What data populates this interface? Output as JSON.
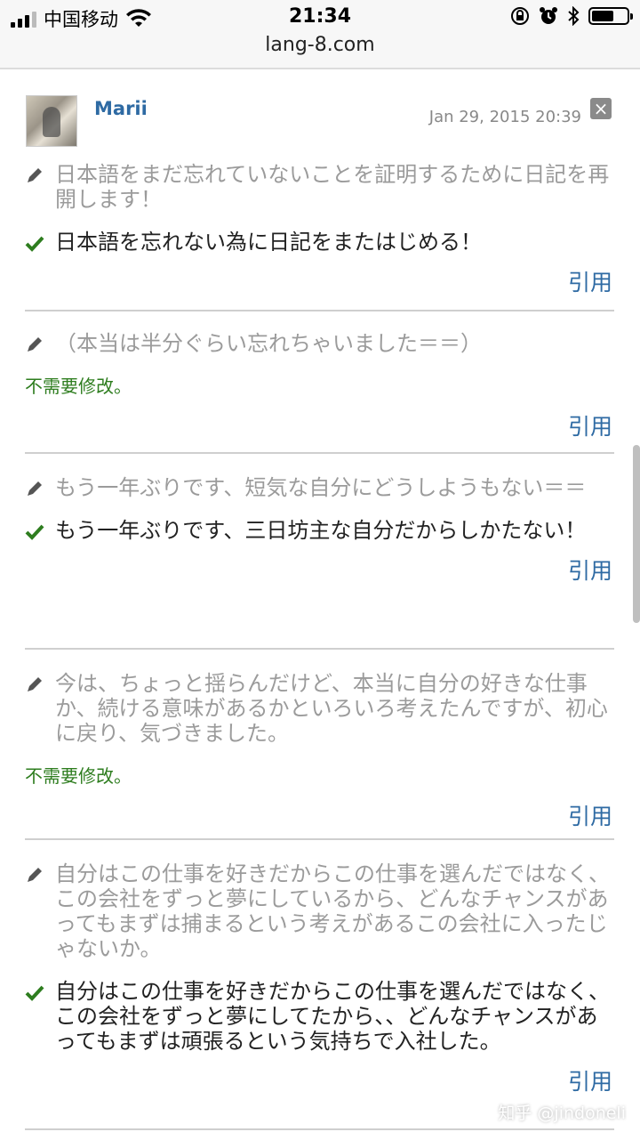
{
  "status_bar": {
    "carrier": "中国移动",
    "time": "21:34",
    "url": "lang-8.com"
  },
  "post": {
    "user": "Marii",
    "date": "Jan 29, 2015 20:39",
    "close_symbol": "×"
  },
  "colors": {
    "link_blue": "#2e6aa3",
    "check_green": "#2e7d1f",
    "original_gray": "#9b9b9b"
  },
  "corrections": [
    {
      "original": "日本語をまだ忘れていないことを証明するために日記を再開します！",
      "corrected": "日本語を忘れない為に日記をまたはじめる！",
      "no_change_text": "",
      "quote_label": "引用"
    },
    {
      "original": "（本当は半分ぐらい忘れちゃいました＝＝）",
      "corrected": "",
      "no_change_text": "不需要修改。",
      "quote_label": "引用"
    },
    {
      "original": "もう一年ぶりです、短気な自分にどうしようもない＝＝",
      "corrected": "もう一年ぶりです、三日坊主な自分だからしかたない！",
      "no_change_text": "",
      "quote_label": "引用"
    },
    {
      "original": "今は、ちょっと揺らんだけど、本当に自分の好きな仕事か、続ける意味があるかといろいろ考えたんですが、初心に戻り、気づきました。",
      "corrected": "",
      "no_change_text": "不需要修改。",
      "quote_label": "引用"
    },
    {
      "original": "自分はこの仕事を好きだからこの仕事を選んだではなく、この会社をずっと夢にしているから、どんなチャンスがあってもまずは捕まるという考えがあるこの会社に入ったじゃないか。",
      "corrected": "自分はこの仕事を好きだからこの仕事を選んだではなく、この会社をずっと夢にしてたから、、どんなチャンスがあってもまずは頑張るという気持ちで入社した。",
      "no_change_text": "",
      "quote_label": "引用"
    }
  ],
  "watermark": "知乎 @jindoneli"
}
